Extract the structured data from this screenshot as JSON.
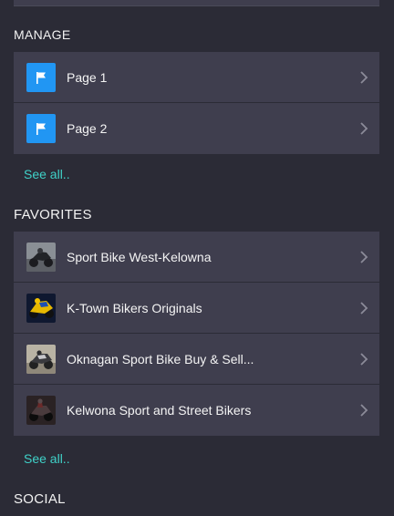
{
  "manage": {
    "header": "MANAGE",
    "items": [
      {
        "label": "Page 1",
        "icon": "flag-icon"
      },
      {
        "label": "Page 2",
        "icon": "flag-icon"
      }
    ],
    "see_all": "See all.."
  },
  "favorites": {
    "header": "FAVORITES",
    "items": [
      {
        "label": "Sport Bike West-Kelowna",
        "icon": "motorcycle-thumbnail"
      },
      {
        "label": "K-Town Bikers Originals",
        "icon": "motorcycle-thumbnail"
      },
      {
        "label": "Oknagan Sport Bike Buy & Sell...",
        "icon": "motorcycle-thumbnail"
      },
      {
        "label": "Kelwona Sport and Street Bikers",
        "icon": "motorcycle-thumbnail"
      }
    ],
    "see_all": "See all.."
  },
  "social": {
    "header": "SOCIAL"
  },
  "colors": {
    "background": "#2b2b36",
    "card": "#3f3e4e",
    "accent_link": "#3fd1c8",
    "flag_tile": "#2196f3"
  }
}
